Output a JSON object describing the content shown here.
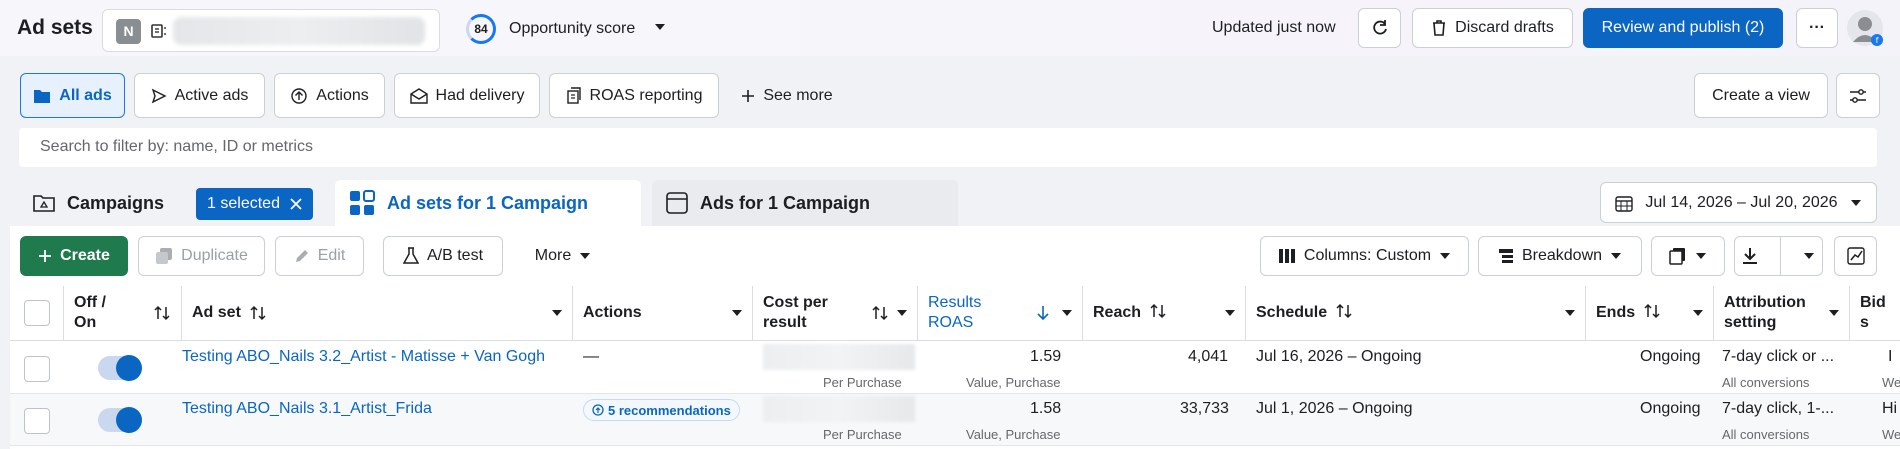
{
  "header": {
    "title": "Ad sets",
    "account_initial": "N",
    "score_value": "84",
    "score_label": "Opportunity score",
    "updated": "Updated just now",
    "discard": "Discard drafts",
    "review": "Review and publish (2)",
    "more": "···"
  },
  "filters": {
    "tabs": [
      "All ads",
      "Active ads",
      "Actions",
      "Had delivery",
      "ROAS reporting"
    ],
    "see_more": "See more",
    "create_view": "Create a view",
    "search_placeholder": "Search to filter by: name, ID or metrics"
  },
  "level_tabs": {
    "campaigns": "Campaigns",
    "selected_chip": "1 selected",
    "adsets": "Ad sets for 1 Campaign",
    "ads": "Ads for 1 Campaign",
    "date_range": "Jul 14, 2026 – Jul 20, 2026"
  },
  "toolbar": {
    "create": "Create",
    "duplicate": "Duplicate",
    "edit": "Edit",
    "ab_test": "A/B test",
    "more": "More",
    "columns": "Columns: Custom",
    "breakdown": "Breakdown"
  },
  "table": {
    "headers": {
      "off_on": "Off / On",
      "ad_set": "Ad set",
      "actions": "Actions",
      "cost_per_result_1": "Cost per",
      "cost_per_result_2": "result",
      "results_1": "Results",
      "results_2": "ROAS",
      "reach": "Reach",
      "schedule": "Schedule",
      "ends": "Ends",
      "attribution_1": "Attribution",
      "attribution_2": "setting",
      "bid": "Bid s"
    },
    "rows": [
      {
        "name": "Testing ABO_Nails 3.2_Artist - Matisse + Van Gogh",
        "actions": "—",
        "cost_sub": "Per Purchase",
        "roas": "1.59",
        "roas_sub": "Value, Purchase",
        "reach": "4,041",
        "schedule": "Jul 16, 2026 – Ongoing",
        "ends": "Ongoing",
        "attribution": "7-day click or ...",
        "attribution_sub": "All conversions",
        "bid": "I",
        "bid_sub": "We"
      },
      {
        "name": "Testing ABO_Nails 3.1_Artist_Frida",
        "actions": "5 recommendations",
        "cost_sub": "Per Purchase",
        "roas": "1.58",
        "roas_sub": "Value, Purchase",
        "reach": "33,733",
        "schedule": "Jul 1, 2026 – Ongoing",
        "ends": "Ongoing",
        "attribution": "7-day click, 1-...",
        "attribution_sub": "All conversions",
        "bid": "Hi",
        "bid_sub": "We"
      }
    ]
  },
  "colors": {
    "primary": "#0a66c2",
    "create_green": "#1f7a4d"
  }
}
